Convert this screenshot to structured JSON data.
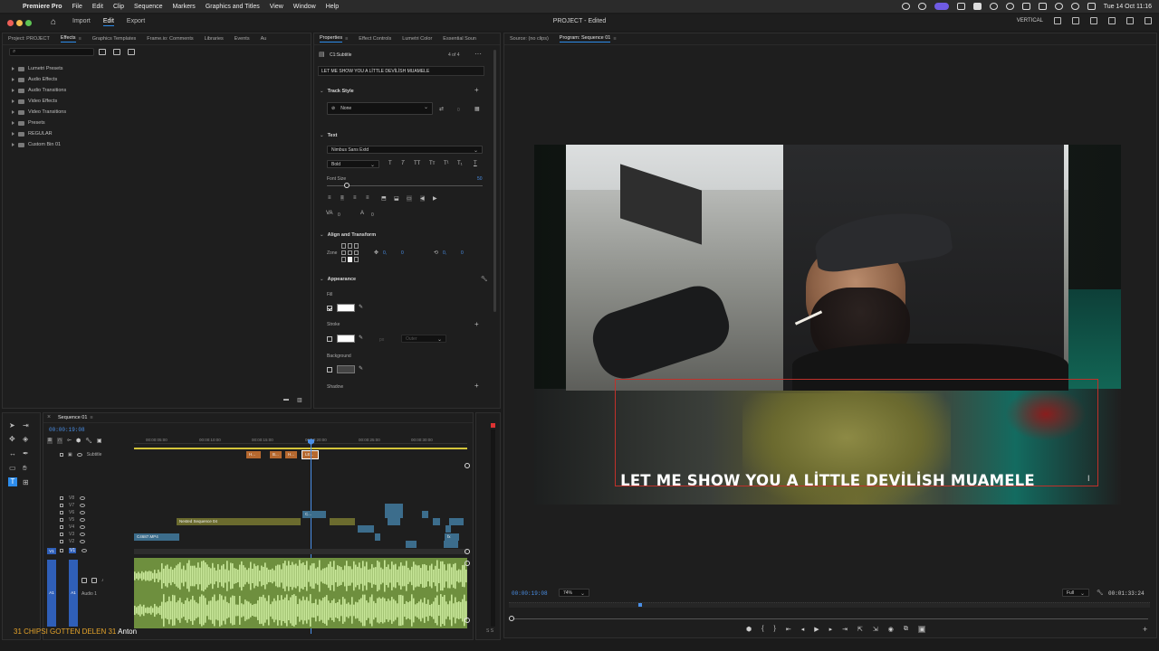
{
  "menubar": {
    "app_name": "Premiere Pro",
    "items": [
      "File",
      "Edit",
      "Clip",
      "Sequence",
      "Markers",
      "Graphics and Titles",
      "View",
      "Window",
      "Help"
    ],
    "clock": "Tue 14 Oct  11:16"
  },
  "header": {
    "workspaces": [
      "Import",
      "Edit",
      "Export"
    ],
    "active_workspace": "Edit",
    "title": "PROJECT - Edited",
    "layout_label": "VERTICAL"
  },
  "left_panel": {
    "tabs": [
      "Project: PROJECT",
      "Effects",
      "Graphics Templates",
      "Frame.io: Comments",
      "Libraries",
      "Events",
      "Au"
    ],
    "active_tab": "Effects",
    "tree": [
      "Lumetri Presets",
      "Audio Effects",
      "Audio Transitions",
      "Video Effects",
      "Video Transitions",
      "Presets",
      "REGULAR",
      "Custom Bin 01"
    ]
  },
  "properties": {
    "tabs": [
      "Properties",
      "Effect Controls",
      "Lumetri Color",
      "Essential Soun"
    ],
    "active_tab": "Properties",
    "clip_name": "C1:Subtitle",
    "counter": "4 of 4",
    "caption_text": "LET ME SHOW YOU A LİTTLE DEVİLİSH MUAMELE",
    "sections": {
      "track_style": "Track Style",
      "text": "Text",
      "align": "Align and Transform",
      "appearance": "Appearance"
    },
    "track_style_value": "None",
    "track_style_count": "0",
    "font": "Nimbus Sans Extd",
    "weight": "Bold",
    "font_size_label": "Font Size",
    "font_size_value": "50",
    "tracking_value": "0",
    "kerning_value": "0",
    "zone_label": "Zone",
    "pos_x": "0,",
    "pos_y": "0",
    "rot_x": "0,",
    "rot_y": "0",
    "fill_label": "Fill",
    "stroke_label": "Stroke",
    "stroke_unit": "px",
    "stroke_type": "Outer",
    "background_label": "Background",
    "shadow_label": "Shadow"
  },
  "program": {
    "tabs": [
      "Source: (no clips)",
      "Program: Sequence 01"
    ],
    "active_tab": "Program: Sequence 01",
    "timecode": "00:00:19:08",
    "zoom": "74%",
    "quality": "Full",
    "duration": "00:01:33:24",
    "subtitle": "LET ME SHOW YOU A LİTTLE DEVİLİSH MUAMELE"
  },
  "timeline": {
    "sequence_tab": "Sequence 01",
    "timecode": "00:00:19:08",
    "ruler": [
      "00:00:05:00",
      "00:00:10:00",
      "00:00:15:00",
      "00:00:20:00",
      "00:00:25:00",
      "00:00:30:00"
    ],
    "subtitle_track": "Subtitle",
    "subtitle_clips": [
      "H...",
      "B...",
      "H...",
      "LE..."
    ],
    "video_tracks": [
      "V8",
      "V7",
      "V6",
      "V5",
      "V4",
      "V3",
      "V2",
      "V1"
    ],
    "nested_clip": "Nested Sequence 04",
    "nested_clip_short": "C...",
    "v2_clip": "C4687.MP4",
    "audio_track_name": "Audio 1",
    "audio_target": "A1",
    "v1_target": "V1",
    "fx": "fx"
  },
  "taskbar_text": "31  CHIPSI  GOTTEN  DELEN  31",
  "taskbar_name": "Anton",
  "colors": {
    "accent": "#2d8ceb",
    "timecode": "#4a8fe7",
    "subtitle_clip": "#b5682f",
    "nested_clip": "#6b6b2e",
    "video_clip": "#3c6d8c",
    "audio_wave": "#c9e89a",
    "audio_bg": "#6e8f3e"
  }
}
